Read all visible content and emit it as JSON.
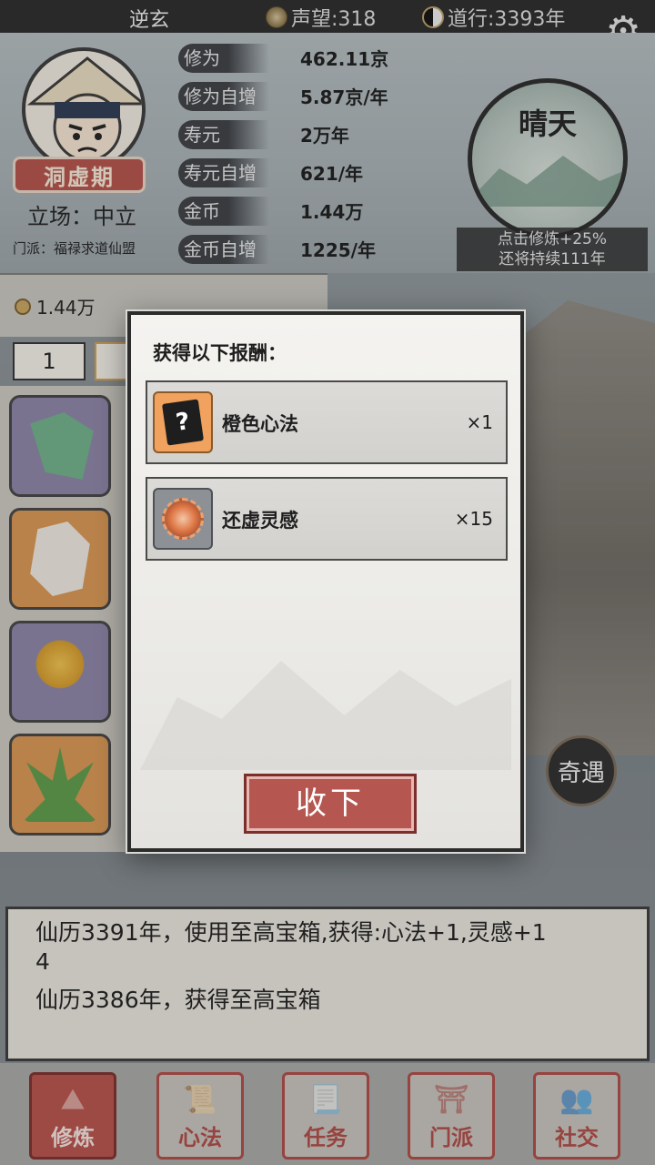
{
  "topbar": {
    "player_name": "逆玄",
    "reputation_label": "声望:318",
    "dao_label": "道行:3393年",
    "settings_icon": "gear-icon"
  },
  "profile": {
    "realm": "洞虚期",
    "stance": "立场：中立",
    "sect": "门派：福禄求道仙盟"
  },
  "stats": [
    {
      "label": "修为",
      "value": "462.11京"
    },
    {
      "label": "修为自增",
      "value": "5.87京/年"
    },
    {
      "label": "寿元",
      "value": "2万年"
    },
    {
      "label": "寿元自增",
      "value": "621/年"
    },
    {
      "label": "金币",
      "value": "1.44万"
    },
    {
      "label": "金币自增",
      "value": "1225/年"
    }
  ],
  "weather": {
    "title": "晴天",
    "note_line1": "点击修炼+25%",
    "note_line2": "还将持续111年"
  },
  "shop": {
    "coins": "1.44万",
    "quantity": "1"
  },
  "qiyu_label": "奇遇",
  "modal": {
    "title": "获得以下报酬：",
    "rewards": [
      {
        "name": "橙色心法",
        "count": "×1",
        "icon": "mystery-book-icon"
      },
      {
        "name": "还虚灵感",
        "count": "×15",
        "icon": "spirit-orb-icon"
      }
    ],
    "accept_label": "收下"
  },
  "log": [
    "仙历3391年，使用至高宝箱,获得:心法+1,灵感+1",
    "4",
    "仙历3386年，获得至高宝箱"
  ],
  "nav": [
    {
      "label": "修炼",
      "active": true
    },
    {
      "label": "心法",
      "active": false
    },
    {
      "label": "任务",
      "active": false
    },
    {
      "label": "门派",
      "active": false
    },
    {
      "label": "社交",
      "active": false
    }
  ],
  "colors": {
    "accent_red": "#b65650",
    "reward_orange": "#f0a25e",
    "dark": "#2c2c2c"
  }
}
